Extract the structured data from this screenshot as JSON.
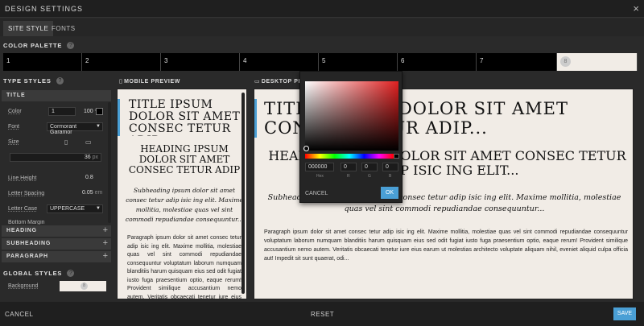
{
  "window": {
    "title": "DESIGN SETTINGS",
    "close": "×"
  },
  "tabs": [
    {
      "label": "SITE STYLE"
    },
    {
      "label": "FONTS"
    }
  ],
  "palette": {
    "label": "COLOR PALETTE",
    "help": "?",
    "swatches": [
      "1",
      "2",
      "3",
      "4",
      "5",
      "6",
      "7",
      "8"
    ]
  },
  "type_styles": {
    "label": "TYPE STYLES",
    "help": "?",
    "title_section": "TITLE",
    "color_label": "Color",
    "color_value": "1",
    "opacity_value": "100",
    "opacity_unit": "%",
    "font_label": "Font",
    "font_value": "Cormorant Garamor",
    "size_label": "Size",
    "size_value": "36",
    "size_unit": "px",
    "line_height_label": "Line Height",
    "line_height_value": "0.8",
    "letter_spacing_label": "Letter Spacing",
    "letter_spacing_value": "0.05",
    "letter_spacing_unit": "em",
    "letter_case_label": "Letter Case",
    "letter_case_value": "UPPERCASE",
    "bottom_margin_label": "Bottom Margin",
    "heading": "HEADING",
    "subheading": "SUBHEADING",
    "paragraph": "PARAGRAPH",
    "plus": "+"
  },
  "global_styles": {
    "label": "GLOBAL STYLES",
    "help": "?",
    "background_label": "Background",
    "background_value": "8"
  },
  "previews": {
    "mobile_label": "MOBILE PREVIEW",
    "desktop_label": "DESKTOP PREVIEW",
    "title": "TITLE IPSUM DOLOR SIT AMET CONSEC TETUR ADIP...",
    "heading": "HEADING IPSUM DOLOR SIT AMET CONSEC TETUR ADIP ISIC ING ELIT...",
    "subheading": "Subheading ipsum dolor sit amet consec tetur adip isic ing elit. Maxime mollitia, molestiae quas vel sint commodi repudiandae consequuntur...",
    "paragraph": "Paragraph ipsum dolor sit amet consec tetur adip isic ing elit. Maxime mollitia, molestiae quas vel sint commodi repudiandae consequuntur voluptatum laborum numquam blanditiis harum quisquam eius sed odit fugiat iusto fuga praesentium optio, eaque rerum! Provident similique accusantium nemo autem. Veritatis obcaecati tenetur iure eius earum ut molestias architecto voluptate aliquam nihil, eveniet aliquid culpa officia aut! Impedit sit sunt quaerat, odi..."
  },
  "picker": {
    "hex": "000000",
    "hex_label": "Hex",
    "r": "0",
    "g": "0",
    "b": "0",
    "r_label": "R",
    "g_label": "G",
    "b_label": "B",
    "cancel": "CANCEL",
    "ok": "OK"
  },
  "footer": {
    "cancel": "CANCEL",
    "reset": "RESET",
    "save": "SAVE"
  },
  "colors": {
    "accent": "#4a9fd5",
    "canvas": "#f1ece6",
    "panel": "#2a2a2a"
  }
}
